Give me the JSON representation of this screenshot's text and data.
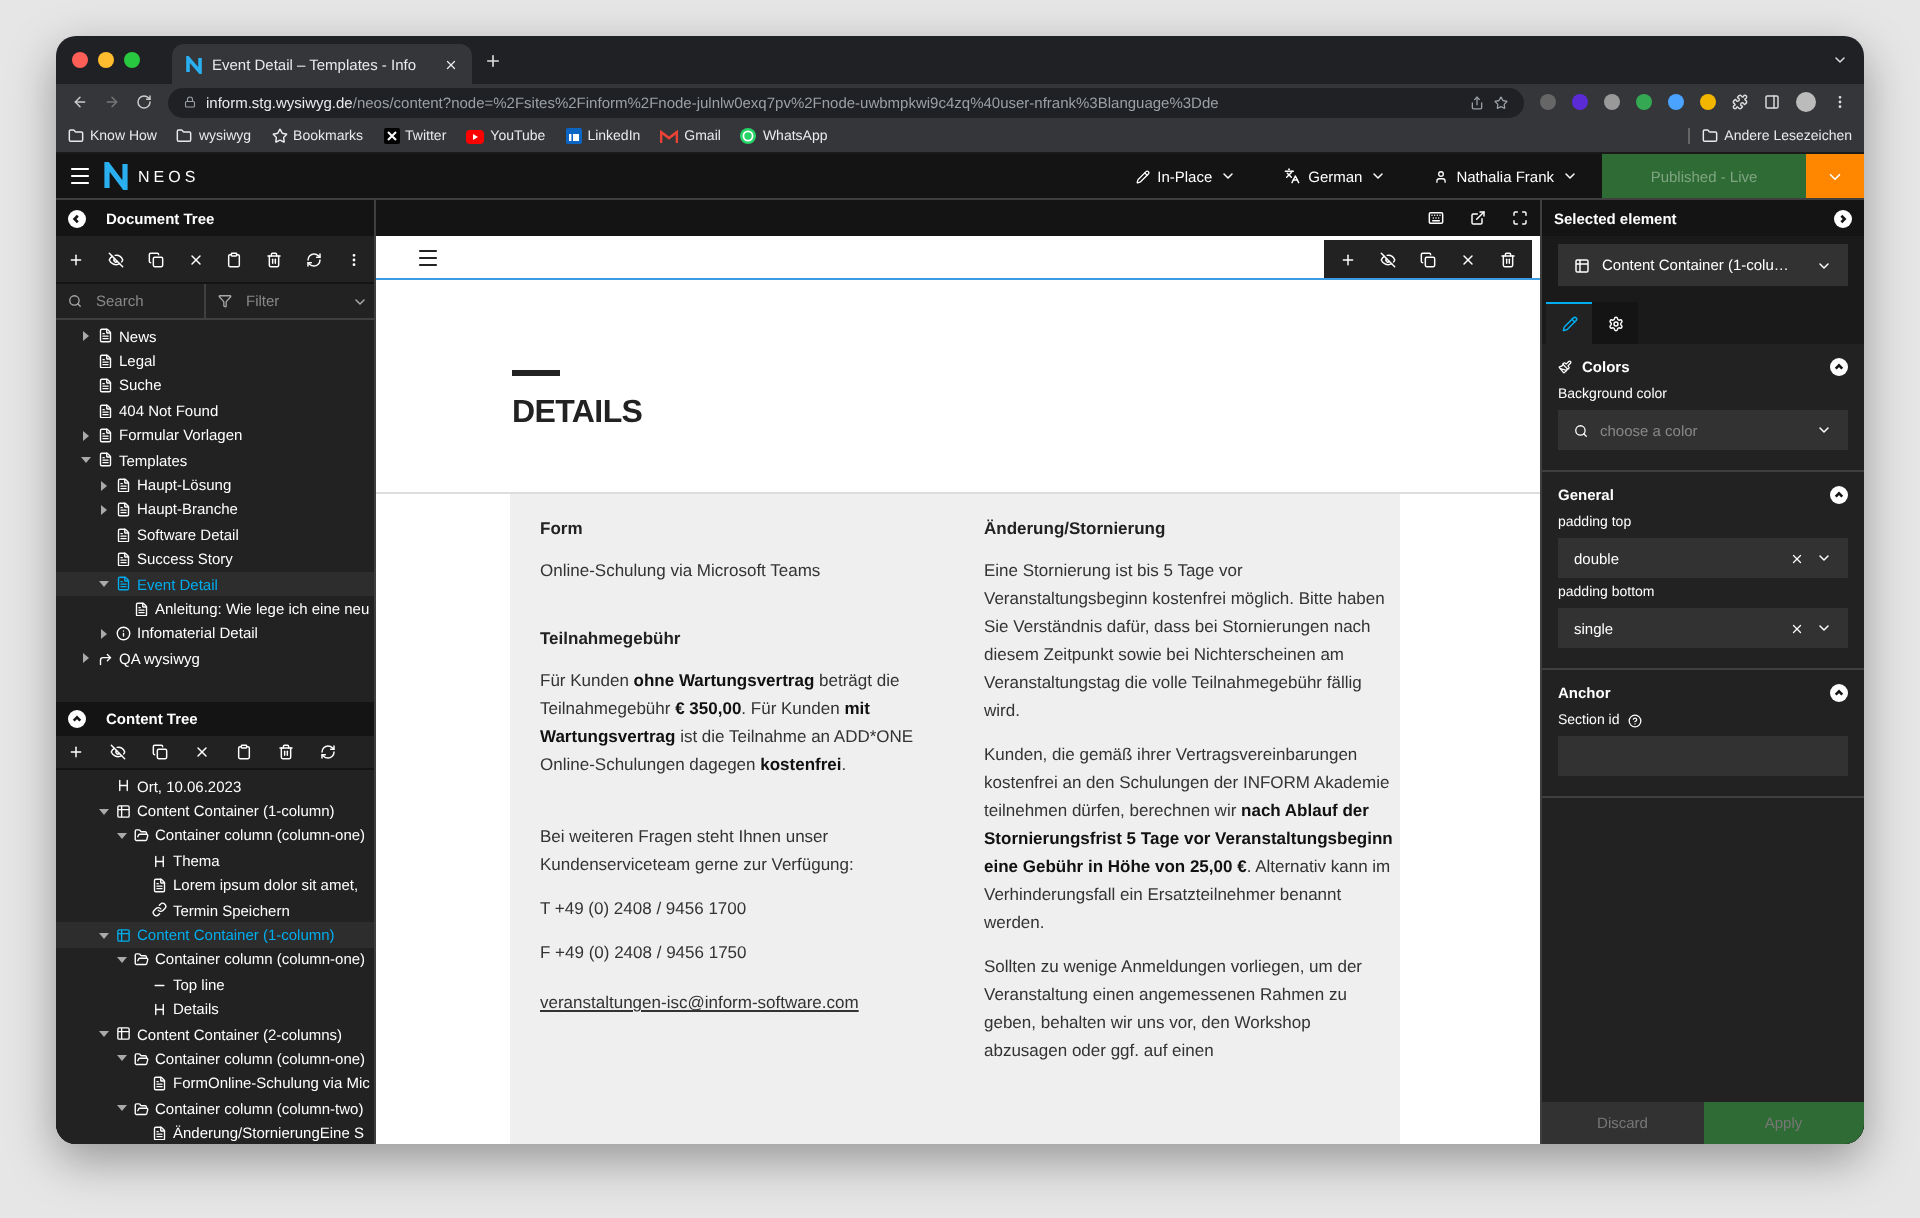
{
  "browser": {
    "tab_title": "Event Detail – Templates - Info",
    "url": "**inform.stg.wysiwyg.de**/neos/content?node=%2Fsites%2Finform%2Fnode-julnlw0exq7pv%2Fnode-uwbmpkwi9c4zq%40user-nfrank%3Blanguage%3Dde",
    "bookmarks": [
      {
        "label": "Know How",
        "kind": "folder"
      },
      {
        "label": "wysiwyg",
        "kind": "folder"
      },
      {
        "label": "Bookmarks",
        "kind": "star"
      },
      {
        "label": "Twitter",
        "kind": "x"
      },
      {
        "label": "YouTube",
        "kind": "youtube"
      },
      {
        "label": "LinkedIn",
        "kind": "linkedin"
      },
      {
        "label": "Gmail",
        "kind": "gmail"
      },
      {
        "label": "WhatsApp",
        "kind": "whatsapp"
      }
    ],
    "other_bookmarks": "Andere Lesezeichen"
  },
  "cms_bar": {
    "brand": "NEOS",
    "edit_mode": "In-Place",
    "language": "German",
    "user": "Nathalia Frank",
    "publish_status": "Published - Live",
    "publish_disabled": true
  },
  "document_tree": {
    "title": "Document Tree",
    "search_placeholder": "Search",
    "filter_placeholder": "Filter",
    "items": [
      {
        "label": "News",
        "kind": "page",
        "expanded": false,
        "selected": false
      },
      {
        "label": "Legal",
        "kind": "page",
        "selected": false
      },
      {
        "label": "Suche",
        "kind": "page",
        "selected": false
      },
      {
        "label": "404 Not Found",
        "kind": "page",
        "selected": false
      },
      {
        "label": "Formular Vorlagen",
        "kind": "page",
        "expanded": false,
        "selected": false
      },
      {
        "label": "Templates",
        "kind": "page",
        "expanded": true,
        "selected": false,
        "children": [
          {
            "label": "Haupt-Lösung",
            "kind": "page",
            "expanded": false,
            "selected": false
          },
          {
            "label": "Haupt-Branche",
            "kind": "page",
            "expanded": false,
            "selected": false
          },
          {
            "label": "Software Detail",
            "kind": "page",
            "selected": false
          },
          {
            "label": "Success Story",
            "kind": "page",
            "selected": false
          },
          {
            "label": "Event Detail",
            "kind": "page",
            "expanded": true,
            "selected": true,
            "children": [
              {
                "label": "Anleitung: Wie lege ich eine neu",
                "kind": "page",
                "selected": false
              }
            ]
          },
          {
            "label": "Infomaterial Detail",
            "kind": "info",
            "expanded": false,
            "selected": false
          }
        ]
      },
      {
        "label": "QA wysiwyg",
        "kind": "shortcut",
        "expanded": false,
        "selected": false
      }
    ]
  },
  "content_tree": {
    "title": "Content Tree",
    "items": [
      {
        "label": "Ort, 10.06.2023",
        "kind": "headline",
        "selected": false
      },
      {
        "label": "Content Container (1-column)",
        "kind": "container",
        "expanded": true,
        "selected": false,
        "children": [
          {
            "label": "Container column (column-one)",
            "kind": "column",
            "expanded": true,
            "selected": false,
            "children": [
              {
                "label": "Thema",
                "kind": "headline",
                "selected": false
              },
              {
                "label": "Lorem ipsum dolor sit amet,",
                "kind": "text",
                "selected": false
              },
              {
                "label": "Termin Speichern",
                "kind": "link",
                "selected": false
              }
            ]
          }
        ]
      },
      {
        "label": "Content Container (1-column)",
        "kind": "container",
        "expanded": true,
        "selected": true,
        "children": [
          {
            "label": "Container column (column-one)",
            "kind": "column",
            "expanded": true,
            "selected": false,
            "children": [
              {
                "label": "Top line",
                "kind": "line",
                "selected": false
              },
              {
                "label": "Details",
                "kind": "headline",
                "selected": false
              }
            ]
          }
        ]
      },
      {
        "label": "Content Container (2-columns)",
        "kind": "container",
        "expanded": true,
        "selected": false,
        "children": [
          {
            "label": "Container column (column-one)",
            "kind": "column",
            "expanded": true,
            "selected": false,
            "children": [
              {
                "label": "FormOnline-Schulung via Mic",
                "kind": "text",
                "selected": false
              }
            ]
          },
          {
            "label": "Container column (column-two)",
            "kind": "column",
            "expanded": true,
            "selected": false,
            "children": [
              {
                "label": "Änderung/StornierungEine S",
                "kind": "text",
                "selected": false
              }
            ]
          }
        ]
      }
    ]
  },
  "page": {
    "heading": "DETAILS",
    "columns": [
      {
        "sections": [
          {
            "blocks": [
              {
                "kind": "heading",
                "text": "Form"
              },
              {
                "kind": "paragraph",
                "text": "Online-Schulung via Microsoft Teams"
              }
            ]
          },
          {
            "blocks": [
              {
                "kind": "heading",
                "text": "Teilnahmegebühr"
              },
              {
                "kind": "paragraph",
                "text": "Für Kunden **ohne Wartungsvertrag** beträgt die Teilnahmegebühr **€ 350,00**. Für Kunden **mit Wartungsvertrag** ist die Teilnahme an ADD*ONE Online-Schulungen dagegen **kostenfrei**."
              }
            ]
          },
          {
            "blocks": [
              {
                "kind": "paragraph",
                "text": "Bei weiteren Fragen steht Ihnen unser Kundenserviceteam gerne zur Verfügung:"
              },
              {
                "kind": "paragraph",
                "text": "T +49 (0) 2408 / 9456 1700"
              },
              {
                "kind": "paragraph",
                "text": "F +49 (0) 2408 / 9456 1750"
              },
              {
                "kind": "link",
                "text": "veranstaltungen-isc@inform-software.com"
              }
            ]
          }
        ]
      },
      {
        "sections": [
          {
            "blocks": [
              {
                "kind": "heading",
                "text": "Änderung/Stornierung"
              },
              {
                "kind": "paragraph",
                "text": "Eine Stornierung ist bis 5 Tage vor Veranstaltungsbeginn kostenfrei möglich. Bitte haben Sie Verständnis dafür, dass bei Stornierungen nach diesem Zeitpunkt sowie bei Nichterscheinen am Veranstaltungstag die volle Teilnahmegebühr fällig wird."
              },
              {
                "kind": "paragraph",
                "text": "Kunden, die gemäß ihrer Vertragsvereinbarungen kostenfrei an den Schulungen der INFORM Akademie teilnehmen dürfen, berechnen wir **nach Ablauf der Stornierungsfrist 5 Tage vor Veranstaltungsbeginn eine Gebühr in Höhe von 25,00 €**. Alternativ kann im Verhinderungsfall ein Ersatzteilnehmer benannt werden."
              },
              {
                "kind": "paragraph",
                "text": "Sollten zu wenige Anmeldungen vorliegen, um der Veranstaltung einen angemessenen Rahmen zu geben, behalten wir uns vor, den Workshop abzusagen oder ggf. auf einen"
              }
            ]
          }
        ]
      }
    ]
  },
  "inspector": {
    "title": "Selected element",
    "element": "Content Container (1-colu…",
    "tabs": [
      {
        "kind": "edit",
        "selected": true
      },
      {
        "kind": "settings",
        "selected": false
      }
    ],
    "groups": [
      {
        "title": "Colors",
        "kind": "colors",
        "expanded": true,
        "fields": [
          {
            "label": "Background color",
            "kind": "color",
            "placeholder": "choose a color"
          }
        ]
      },
      {
        "title": "General",
        "kind": "plain",
        "expanded": true,
        "fields": [
          {
            "label": "padding top",
            "kind": "select",
            "value": "double"
          },
          {
            "label": "padding bottom",
            "kind": "select",
            "value": "single"
          }
        ]
      },
      {
        "title": "Anchor",
        "kind": "plain",
        "expanded": true,
        "fields": [
          {
            "label": "Section id",
            "kind": "text"
          }
        ]
      }
    ],
    "buttons": [
      {
        "label": "Discard",
        "kind": "secondary",
        "disabled": true
      },
      {
        "label": "Apply",
        "kind": "primary",
        "disabled": true
      }
    ]
  }
}
